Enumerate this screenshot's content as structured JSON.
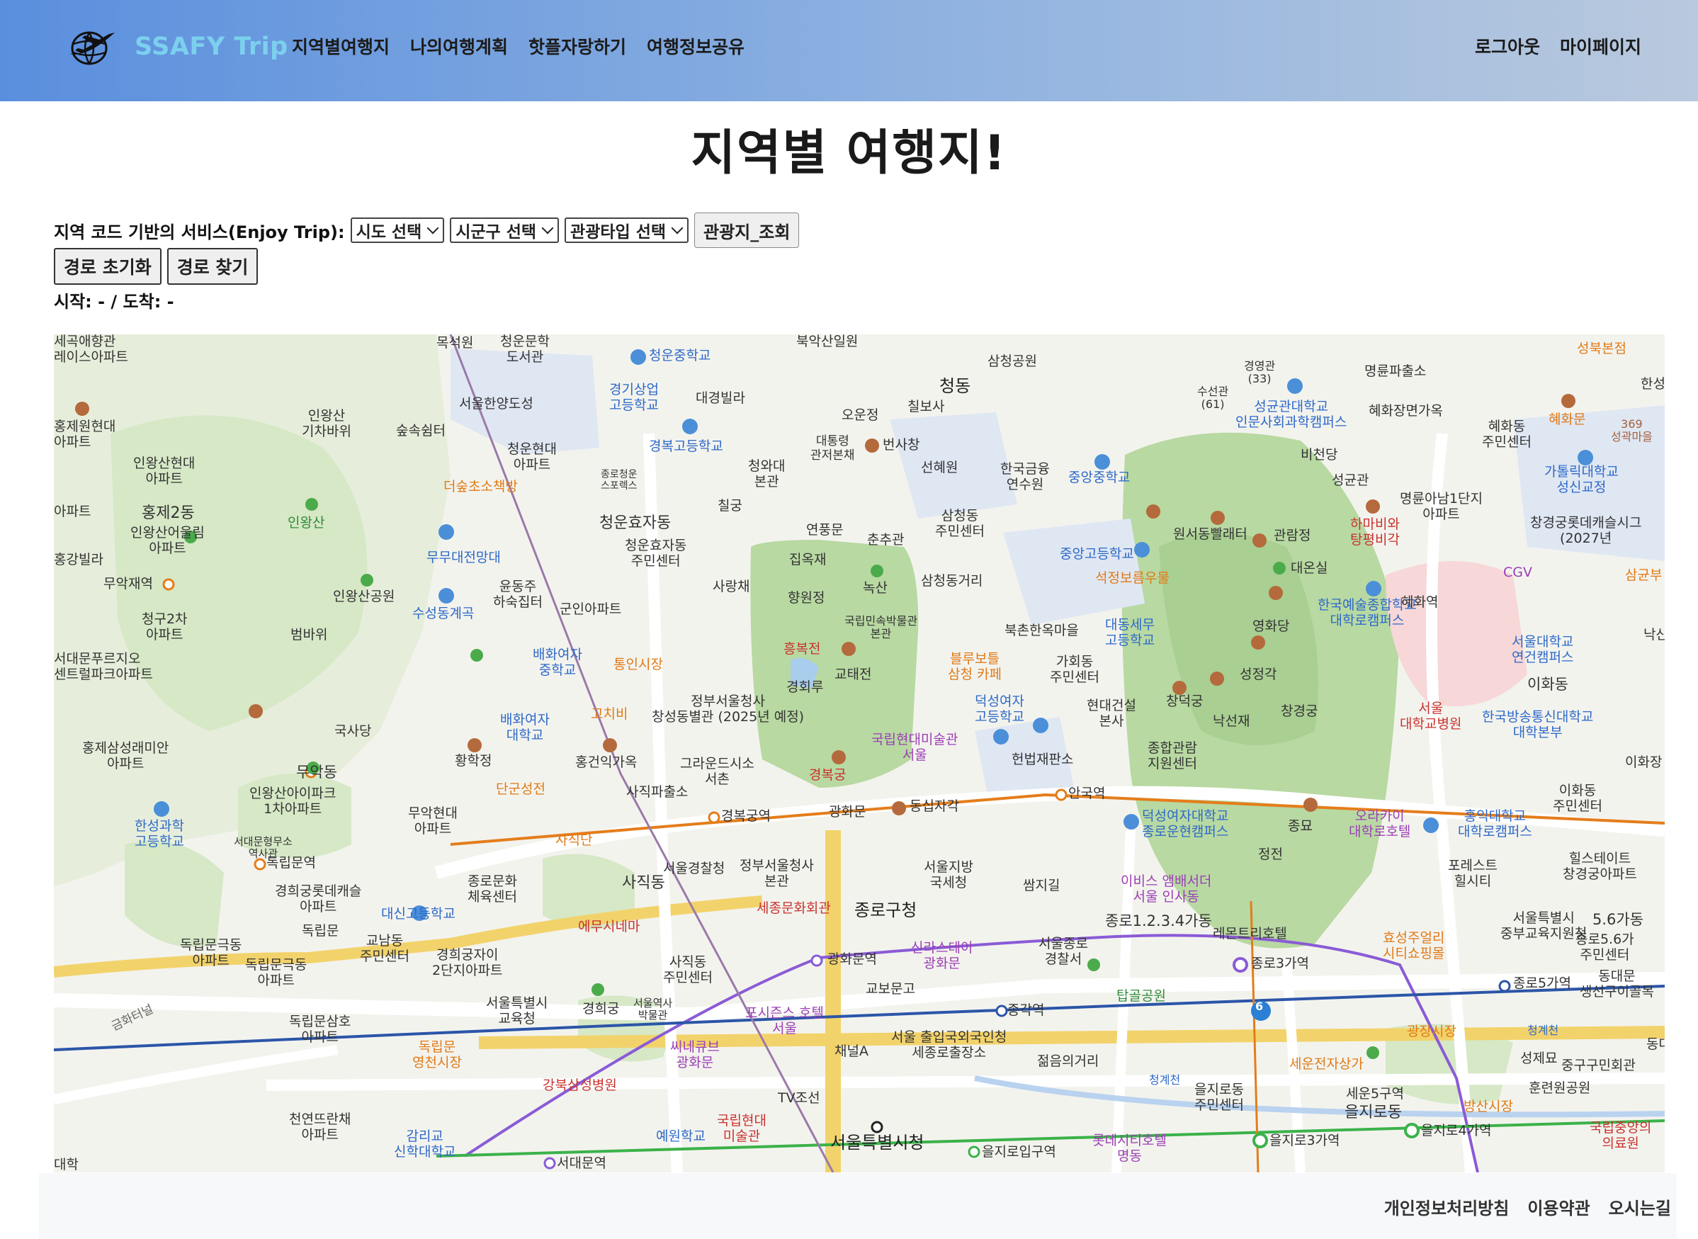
{
  "header": {
    "brand_name": "SSAFY Trip",
    "nav": [
      {
        "label": "지역별여행지"
      },
      {
        "label": "나의여행계획"
      },
      {
        "label": "핫플자랑하기"
      },
      {
        "label": "여행정보공유"
      }
    ],
    "right": [
      {
        "label": "로그아웃"
      },
      {
        "label": "마이페이지"
      }
    ],
    "logo_icon": "airplane-globe-icon"
  },
  "page": {
    "title": "지역별 여행지!"
  },
  "search": {
    "label": "지역 코드 기반의 서비스(Enjoy Trip):",
    "sido": "시도 선택",
    "sigungu": "시군구 선택",
    "content_type": "관광타입 선택",
    "view_button": "관광지_조회"
  },
  "route": {
    "reset_button": "경로 초기화",
    "find_button": "경로 찾기",
    "status": "시작: - / 도착: -"
  },
  "map": {
    "labels": {
      "l1": "세곡애향관\n레이스아파트",
      "l2": "목석원",
      "l3": "청운문학\n도서관",
      "l4": "청운중학교",
      "l5": "북악산일원",
      "l6": "삼청공원",
      "l7": "경영관\n(33)",
      "l8": "명륜파출소",
      "l9": "성북본점",
      "l10": "한성",
      "l11": "인왕산\n기차바위",
      "l12": "숲속쉼터",
      "l13": "서울한양도성",
      "l14": "경기상업\n고등학교",
      "l15": "대경빌라",
      "l16": "청동",
      "l17": "칠보사",
      "l18": "오운정",
      "l19": "수선관\n(61)",
      "l20": "성균관대학교\n인문사회과학캠퍼스",
      "l21": "혜화장면가옥",
      "l22": "혜화동\n주민센터",
      "l23": "혜화문",
      "l24": "369\n성곽마을",
      "l25": "홍제원현대\n아파트",
      "l26": "인왕산현대\n아파트",
      "l27": "청운현대\n아파트",
      "l28": "경복고등학교",
      "l29": "대통령\n관저본채",
      "l30": "번사창",
      "l31": "선혜원",
      "l32": "한국금융\n연수원",
      "l33": "중앙중학교",
      "l34": "비천당",
      "l35": "성균관",
      "l36": "가톨릭대학교\n성신교정",
      "l37": "아파트",
      "l38": "홍제2동",
      "l39": "인왕산",
      "l40": "인왕산어울림\n아파트",
      "l41": "더숲초소책방",
      "l42": "종로청운\n스포렉스",
      "l43": "청와대\n본관",
      "l44": "칠궁",
      "l45": "삼청동\n주민센터",
      "l46": "명륜아남1단지\n아파트",
      "l47": "창경궁롯데캐슬시그\n(2027년",
      "l48": "하마비와\n탕평비각",
      "l49": "청운효자동",
      "l50": "청운효자동\n주민센터",
      "l51": "연풍문",
      "l52": "춘추관",
      "l53": "원서동빨래터",
      "l54": "관람정",
      "l55": "CGV",
      "l56": "홍강빌라",
      "l57": "무무대전망대",
      "l58": "집옥재",
      "l59": "녹산",
      "l60": "중앙고등학교",
      "l61": "대온실",
      "l62": "삼균부",
      "l63": "무악재역",
      "l64": "인왕산공원",
      "l65": "윤동주\n하숙집터",
      "l66": "군인아파트",
      "l67": "사랑채",
      "l68": "향원정",
      "l69": "삼청동거리",
      "l70": "석정보름우물",
      "l71": "한국예술종합학교\n대학로캠퍼스",
      "l72": "혜화역",
      "l73": "청구2차\n아파트",
      "l74": "수성동계곡",
      "l75": "범바위",
      "l76": "국립민속박물관\n본관",
      "l77": "북촌한옥마을",
      "l78": "대동세무\n고등학교",
      "l79": "영화당",
      "l80": "서울대학교\n연건캠퍼스",
      "l81": "낙산",
      "l82": "서대문푸르지오\n센트럴파크아파트",
      "l83": "배화여자\n중학교",
      "l84": "통인시장",
      "l85": "흥복전",
      "l86": "교태전",
      "l87": "블루보틀\n삼청 카페",
      "l88": "가회동\n주민센터",
      "l89": "성정각",
      "l90": "서울\n대학교병원",
      "l91": "이화동",
      "l92": "경회루",
      "l93": "정부서울청사\n창성동별관 (2025년 예정)",
      "l94": "창덕궁",
      "l95": "창경궁",
      "l96": "낙선재",
      "l97": "한국방송통신대학교\n대학본부",
      "l98": "국사당",
      "l99": "배화여자\n대학교",
      "l100": "고치비",
      "l101": "덕성여자\n고등학교",
      "l102": "현대건설\n본사",
      "l103": "국립현대미술관\n서울",
      "l104": "홍제삼성래미안\n아파트",
      "l105": "황학정",
      "l106": "홍건익가옥",
      "l107": "그라운드시소\n서촌",
      "l108": "헌법재판소",
      "l109": "종합관람\n지원센터",
      "l110": "이화장",
      "l111": "무악동",
      "l112": "인왕산아이파크\n1차아파트",
      "l113": "단군성전",
      "l114": "사직파출소",
      "l115": "경복궁",
      "l116": "안국역",
      "l117": "이화동\n주민센터",
      "l118": "한성과학\n고등학교",
      "l119": "무악현대\n아파트",
      "l120": "사직단",
      "l121": "경복궁역",
      "l122": "광화문",
      "l123": "동십자각",
      "l124": "덕성여자대학교\n종로운현캠퍼스",
      "l125": "오라카이\n대학로호텔",
      "l126": "홍익대학교\n대학로캠퍼스",
      "l127": "종묘",
      "l128": "힐스테이트\n창경궁아파트",
      "l129": "서대문형무소\n역사관",
      "l130": "독립문역",
      "l131": "종로문화\n체육센터",
      "l132": "서울경찰청",
      "l133": "정부서울청사\n본관",
      "l134": "서울지방\n국세청",
      "l135": "쌈지길",
      "l136": "정전",
      "l137": "포레스트\n힐시티",
      "l138": "경희궁롯데캐슬\n아파트",
      "l139": "사직동",
      "l140": "세종문화회관",
      "l141": "종로구청",
      "l142": "이비스 앰배서더\n서울 인사동",
      "l143": "서울특별시\n중부교육지원청",
      "l144": "5.6가동",
      "l145": "독립문",
      "l146": "대신고등학교",
      "l147": "교남동\n주민센터",
      "l148": "에무시네마",
      "l149": "신라스테이\n광화문",
      "l150": "종로1.2.3.4가동",
      "l151": "레몬트리호텔",
      "l152": "효성주얼리\n시티쇼핑몰",
      "l153": "종로5.6가\n주민센터",
      "l154": "독립문극동\n아파트",
      "l155": "독립문극동\n아파트",
      "l156": "경희궁자이\n2단지아파트",
      "l157": "사직동\n주민센터",
      "l158": "광화문역",
      "l159": "서울종로\n경찰서",
      "l160": "종로3가역",
      "l161": "종로5가역",
      "l162": "동대문\n생선구이골목",
      "l163": "금화터널",
      "l164": "서울특별시\n교육청",
      "l165": "경희궁",
      "l166": "서울역사\n박물관",
      "l167": "교보문고",
      "l168": "탑골공원",
      "l169": "독립문삼호\n아파트",
      "l170": "포시즌스 호텔\n서울",
      "l171": "종각역",
      "l172": "광장시장",
      "l173": "청계천",
      "l174": "동대",
      "l175": "독립문\n영천시장",
      "l176": "씨네큐브\n광화문",
      "l177": "채널A",
      "l178": "서울 출입국외국인청\n세종로출장소",
      "l179": "젊음의거리",
      "l180": "세운전자상가",
      "l181": "성제묘",
      "l182": "중구구민회관",
      "l183": "강북삼성병원",
      "l184": "TV조선",
      "l185": "청계천",
      "l186": "을지로동\n주민센터",
      "l187": "세운5구역",
      "l188": "을지로동",
      "l189": "방산시장",
      "l190": "훈련원공원",
      "l191": "국립중앙의\n의료원",
      "l192": "천연뜨란채\n아파트",
      "l193": "감리교\n신학대학교",
      "l194": "예원학교",
      "l195": "국립현대\n미술관",
      "l196": "서울특별시청",
      "l197": "을지로입구역",
      "l198": "롯데시티호텔\n명동",
      "l199": "을지로3가역",
      "l200": "을지로4가역",
      "l201": "서대문역",
      "l202": "대학",
      "l203": "6"
    }
  },
  "footer": {
    "links": [
      {
        "label": "개인정보처리방침"
      },
      {
        "label": "이용약관"
      },
      {
        "label": "오시는길"
      }
    ]
  },
  "colors": {
    "nav_gradient_start": "#5a8fde",
    "nav_gradient_end": "#b9c9de",
    "brand": "#7cd0ee",
    "park_green": "#bcdcaa",
    "subway_orange": "#e47d1b",
    "subway_purple": "#8a5bd6",
    "subway_blue": "#2b55a8",
    "subway_green": "#3bb24a"
  }
}
